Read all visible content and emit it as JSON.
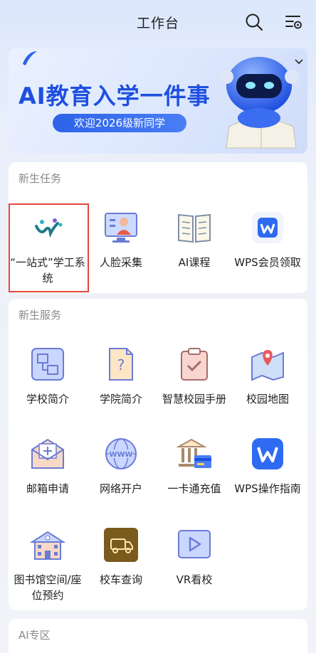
{
  "header": {
    "title": "工作台",
    "search_icon": "search-icon",
    "settings_icon": "settings-icon"
  },
  "banner": {
    "headline": "AI教育入学一件事",
    "subtitle": "欢迎2026级新同学"
  },
  "new_tasks": {
    "title": "新生任务",
    "items": [
      {
        "label": "“一站式”学工系统",
        "icon": "yizhanshi-logo-icon"
      },
      {
        "label": "人脸采集",
        "icon": "face-capture-icon"
      },
      {
        "label": "AI课程",
        "icon": "book-icon"
      },
      {
        "label": "WPS会员领取",
        "icon": "wps-icon"
      }
    ]
  },
  "new_services": {
    "title": "新生服务",
    "items": [
      {
        "label": "学校简介",
        "icon": "school-intro-icon"
      },
      {
        "label": "学院简介",
        "icon": "college-intro-icon"
      },
      {
        "label": "智慧校园手册",
        "icon": "clipboard-icon"
      },
      {
        "label": "校园地图",
        "icon": "map-icon"
      },
      {
        "label": "邮箱申请",
        "icon": "mail-icon"
      },
      {
        "label": "网络开户",
        "icon": "globe-icon"
      },
      {
        "label": "一卡通充值",
        "icon": "bank-card-icon"
      },
      {
        "label": "WPS操作指南",
        "icon": "wps-icon"
      },
      {
        "label": "图书馆空间/座位预约",
        "icon": "library-icon"
      },
      {
        "label": "校车查询",
        "icon": "bus-icon"
      },
      {
        "label": "VR看校",
        "icon": "play-icon"
      }
    ]
  },
  "ai_zone": {
    "title": "AI专区"
  },
  "colors": {
    "accent": "#2d63e8",
    "highlight": "#e5473a"
  }
}
